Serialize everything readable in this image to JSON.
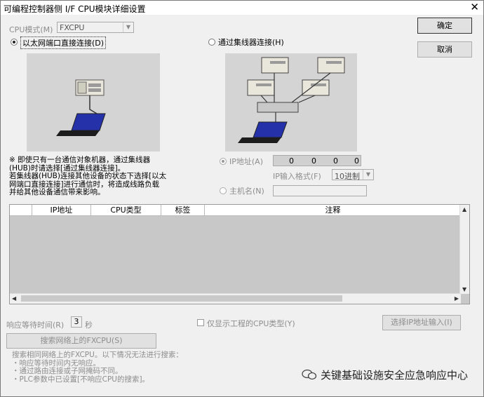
{
  "window": {
    "title": "可编程控制器侧 I/F CPU模块详细设置",
    "close_glyph": "✕"
  },
  "cpu_mode": {
    "label": "CPU模式(M)",
    "value": "FXCPU"
  },
  "buttons": {
    "ok": "确定",
    "cancel": "取消",
    "search": "搜索网络上的FXCPU(S)",
    "select_ip": "选择IP地址输入(I)"
  },
  "connection": {
    "direct_label": "以太网端口直接连接(D)",
    "hub_label": "通过集线器连接(H)",
    "selected": "direct"
  },
  "note": [
    "※ 即使只有一台通信对象机器，通过集线器",
    "(HUB)时请选择[通过集线器连接]。",
    "若集线器(HUB)连接其他设备的状态下选择[以太",
    "网端口直接连接]进行通信时，将造成线路负载",
    "并给其他设备通信带来影响。"
  ],
  "ip_address": {
    "label": "IP地址(A)",
    "octets": [
      "0",
      "0",
      "0",
      "0"
    ]
  },
  "ip_format": {
    "label": "IP输入格式(F)",
    "value": "10进制"
  },
  "host_name": {
    "label": "主机名(N)",
    "value": ""
  },
  "table": {
    "columns": [
      "IP地址",
      "CPU类型",
      "标签",
      "注释"
    ],
    "rows": []
  },
  "response_wait": {
    "label": "响应等待时间(R)",
    "value": "3",
    "unit": "秒"
  },
  "show_only_project_cpu": {
    "label": "仅显示工程的CPU类型(Y)",
    "checked": false
  },
  "search_info": [
    "搜索相同网络上的FXCPU。以下情况无法进行搜索：",
    "・响应等待时间内无响应。",
    "・通过路由连接或子网掩码不同。",
    "・PLC参数中已设置[不响应CPU的搜索]。"
  ],
  "watermark": "关键基础设施安全应急响应中心",
  "colors": {
    "screen_blue": "#2431a8",
    "pc_beige": "#e9e6dc",
    "panel_gray": "#d4d4d4"
  }
}
